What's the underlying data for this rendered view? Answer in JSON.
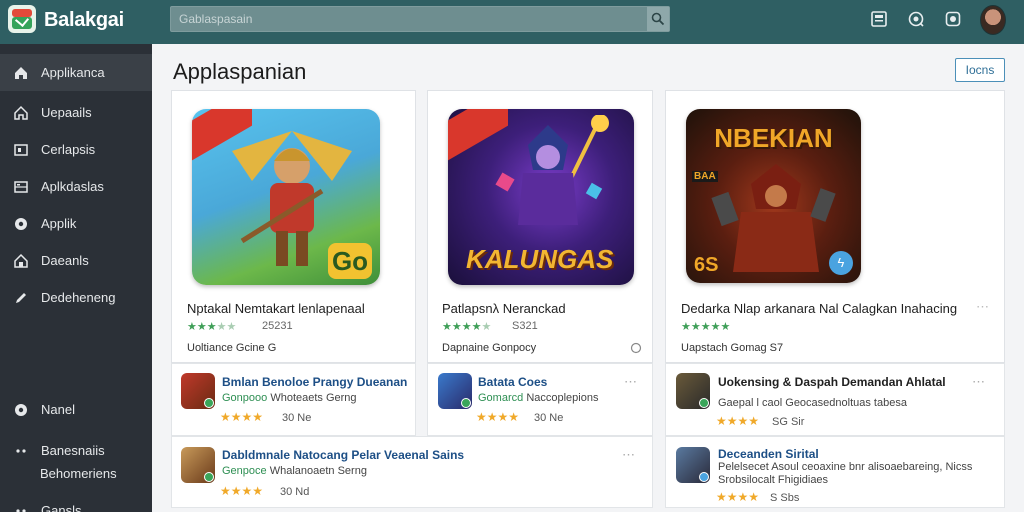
{
  "header": {
    "app_title": "Balakgai",
    "search_placeholder": "Gablaspasain",
    "icons": [
      "search-icon",
      "library-icon",
      "help-icon",
      "settings-icon",
      "profile-avatar"
    ]
  },
  "sidebar": {
    "items": [
      {
        "label": "Applikanca",
        "icon": "home-icon",
        "active": true
      },
      {
        "label": "Uepaails",
        "icon": "home-icon"
      },
      {
        "label": "Cerlapsis",
        "icon": "tv-icon"
      },
      {
        "label": "Aplkdaslas",
        "icon": "grid-icon"
      },
      {
        "label": "Applik",
        "icon": "circle-icon"
      },
      {
        "label": "Daeanls",
        "icon": "home-icon"
      },
      {
        "label": "Dedeheneng",
        "icon": "pen-icon"
      },
      {
        "label": "Nanel",
        "icon": "circle-icon"
      },
      {
        "label": "Banesnaiis",
        "icon": "dots-icon"
      },
      {
        "label": "Behomeriens",
        "icon": ""
      },
      {
        "label": "Gansls",
        "icon": "dots-icon"
      }
    ]
  },
  "main": {
    "title": "Applaspanian",
    "top_button": "Iocns"
  },
  "featured": [
    {
      "name": "Nptakal Nemtakart lenlapenaal",
      "rating_value": 3.5,
      "reviews": "25231",
      "meta": "Uoltiance Gcine G",
      "art_text": "Go",
      "colors": {
        "bg1": "#4fb7e8",
        "bg2": "#6ab04c",
        "accent": "#f2c230"
      }
    },
    {
      "name": "Patlapsnλ Neranckad",
      "rating_value": 4,
      "reviews": "S321",
      "meta": "Dapnaine Gonpocy",
      "art_text": "KALUNGAS",
      "colors": {
        "bg1": "#2a1e6b",
        "bg2": "#d8322c",
        "accent": "#f2b632"
      }
    },
    {
      "name": "Dedarka Nlap arkanara Nal Calagkan Inahacing",
      "rating_value": 5,
      "reviews": "",
      "meta": "Uapstach Gomag S7",
      "art_text": "NBEKIAN",
      "art_subtext": "BAA",
      "art_corner": "6S",
      "colors": {
        "bg1": "#3a2414",
        "bg2": "#8a2c1a",
        "accent": "#f0a728"
      }
    }
  ],
  "list_rows": [
    {
      "title": "Bmlan Benoloe Prangy Dueanan",
      "publisher": "Gonpooo",
      "subtitle": "Whoteaets Gerng",
      "stars": "★★★★",
      "count": "30 Ne"
    },
    {
      "title": "Batata Coes",
      "publisher": "Gomarcd",
      "subtitle": "Naccoplepions",
      "stars": "★★★★",
      "count": "30 Ne"
    },
    {
      "title": "Uokensing & Daspah Demandan Ahlatal",
      "publisher": "",
      "subtitle": "Gaepal l caol Geocasednoltuas tabesa",
      "stars": "★★★★",
      "count": "SG Sir"
    },
    {
      "title": "Dabldmnale Natocang Pelar Veaenal Sains",
      "publisher": "Genpoce",
      "subtitle": "Whalanoaetn Serng",
      "stars": "★★★★",
      "count": "30 Nd"
    },
    {
      "title": "Deceanden Sirital",
      "publisher": "",
      "subtitle": "Pelelsecet Asoul ceoaxine bnr alisoaebareing, Nicss",
      "subtitle2": "Srobsilocalt Fhigidiaes",
      "stars": "★★★★",
      "count": "S Sbs"
    }
  ],
  "rating_color": "#3f9f58",
  "star_color": "#f0a92a"
}
